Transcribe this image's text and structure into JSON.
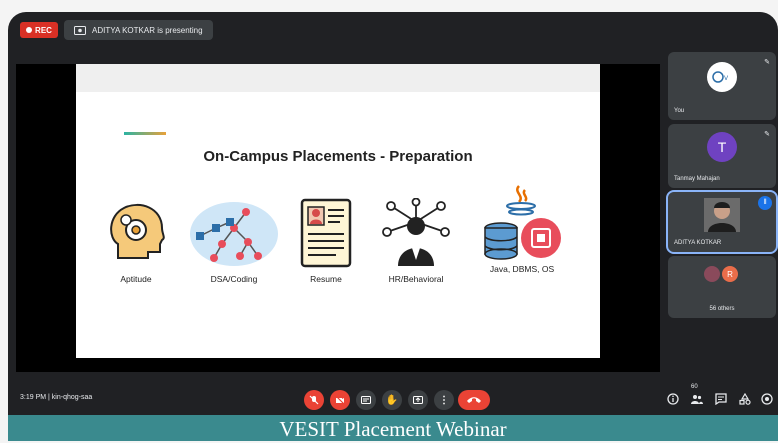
{
  "top_bar": {
    "rec_label": "REC",
    "presenting_text": "ADITYA KOTKAR is presenting"
  },
  "slide": {
    "title": "On-Campus Placements - Preparation",
    "topics": [
      {
        "label": "Aptitude",
        "icon": "head-gear-icon"
      },
      {
        "label": "DSA/Coding",
        "icon": "graph-tree-icon"
      },
      {
        "label": "Resume",
        "icon": "resume-doc-icon"
      },
      {
        "label": "HR/Behavioral",
        "icon": "person-network-icon"
      },
      {
        "label": "Java, DBMS, OS",
        "icon": "java-database-chip-icon"
      }
    ]
  },
  "participants": [
    {
      "name": "You",
      "type": "logo"
    },
    {
      "name": "Tanmay Mahajan",
      "initial": "T",
      "color": "#6f42c1"
    },
    {
      "name": "ADITYA KOTKAR",
      "type": "video",
      "active": true
    },
    {
      "name": "56 others",
      "initial": "R",
      "color": "#ea6d4a"
    }
  ],
  "bottom_bar": {
    "time": "3:19 PM",
    "meeting_code": "kin-qhog-saa",
    "participant_count": "60"
  },
  "caption": "VESIT Placement Webinar",
  "colors": {
    "accent": "#1a73e8",
    "danger": "#ea4335",
    "caption_bg": "#3a8a8e"
  }
}
